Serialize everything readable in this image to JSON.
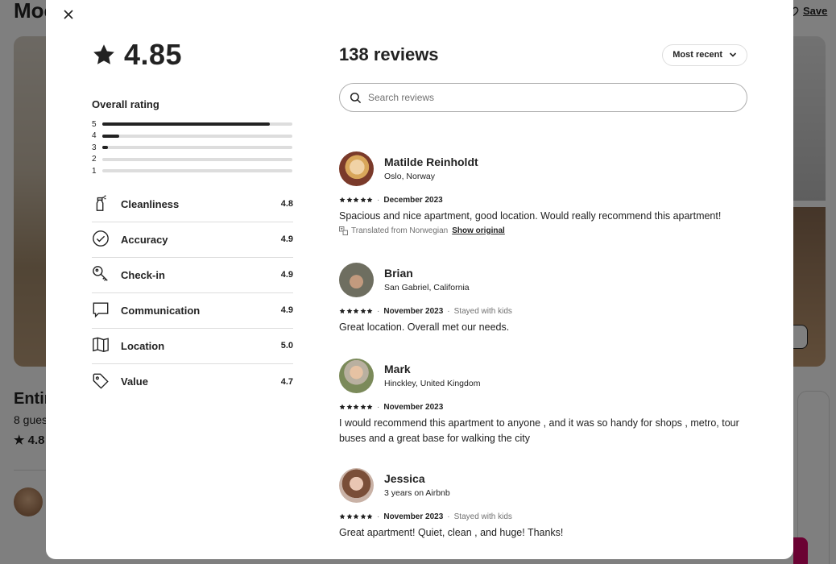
{
  "background": {
    "title": "Moc",
    "save_label": "Save",
    "listing_title": "Entir",
    "guests": "8 gues",
    "rating": "4.8"
  },
  "modal": {
    "overall": {
      "rating": "4.85",
      "label": "Overall rating",
      "distribution": [
        {
          "stars": "5",
          "fraction": 0.88
        },
        {
          "stars": "4",
          "fraction": 0.09
        },
        {
          "stars": "3",
          "fraction": 0.03
        },
        {
          "stars": "2",
          "fraction": 0.0
        },
        {
          "stars": "1",
          "fraction": 0.0
        }
      ]
    },
    "categories": [
      {
        "label": "Cleanliness",
        "score": "4.8",
        "icon": "spray-bottle-icon"
      },
      {
        "label": "Accuracy",
        "score": "4.9",
        "icon": "check-circle-icon"
      },
      {
        "label": "Check-in",
        "score": "4.9",
        "icon": "key-icon"
      },
      {
        "label": "Communication",
        "score": "4.9",
        "icon": "chat-bubble-icon"
      },
      {
        "label": "Location",
        "score": "5.0",
        "icon": "map-icon"
      },
      {
        "label": "Value",
        "score": "4.7",
        "icon": "tag-icon"
      }
    ],
    "reviews_header": "138 reviews",
    "sort_label": "Most recent",
    "search_placeholder": "Search reviews",
    "reviews": [
      {
        "name": "Matilde Reinholdt",
        "sub": "Oslo, Norway",
        "stars": 5,
        "date": "December 2023",
        "stay": "",
        "text": "Spacious and nice apartment, good location. Would really recommend this apartment!",
        "translated": "Translated from Norwegian",
        "show_original": "Show original"
      },
      {
        "name": "Brian",
        "sub": "San Gabriel, California",
        "stars": 5,
        "date": "November 2023",
        "stay": "Stayed with kids",
        "text": "Great location. Overall met our needs."
      },
      {
        "name": "Mark",
        "sub": "Hinckley, United Kingdom",
        "stars": 5,
        "date": "November 2023",
        "stay": "",
        "text": "I would recommend this apartment to anyone , and it was so handy for shops , metro, tour buses and a great base for walking the city"
      },
      {
        "name": "Jessica",
        "sub": "3 years on Airbnb",
        "stars": 5,
        "date": "November 2023",
        "stay": "Stayed with kids",
        "text": "Great apartment! Quiet, clean , and huge! Thanks!"
      }
    ]
  }
}
